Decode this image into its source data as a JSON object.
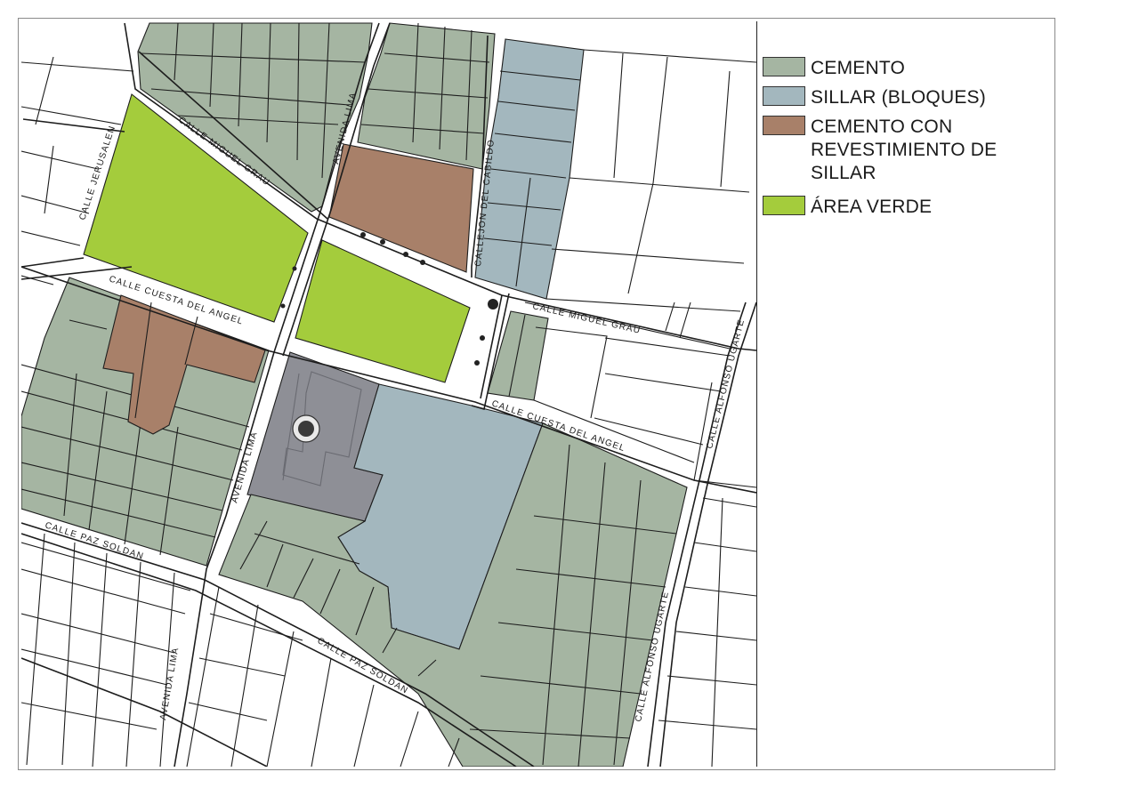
{
  "legend": {
    "items": [
      {
        "key": "cemento",
        "label": "CEMENTO",
        "color": "#a5b5a2"
      },
      {
        "key": "sillar",
        "label": "SILLAR (BLOQUES)",
        "color": "#a3b7be"
      },
      {
        "key": "revestimiento",
        "label": "CEMENTO CON\nREVESTIMIENTO DE\nSILLAR",
        "color": "#a88069"
      },
      {
        "key": "area_verde",
        "label": "ÁREA VERDE",
        "color": "#a4cc3c"
      }
    ]
  },
  "plaza": {
    "color": "#8e8f96"
  },
  "streets": [
    {
      "key": "jerusalen",
      "label": "CALLE JERUSALEN"
    },
    {
      "key": "miguel_grau_1",
      "label": "CALLE MIGUEL GRAU"
    },
    {
      "key": "lima_1",
      "label": "AVENIDA LIMA"
    },
    {
      "key": "cabildo",
      "label": "CALLEJON DEL CABILDO"
    },
    {
      "key": "miguel_grau_2",
      "label": "CALLE MIGUEL GRAU"
    },
    {
      "key": "cuesta_1",
      "label": "CALLE CUESTA DEL ANGEL"
    },
    {
      "key": "cuesta_2",
      "label": "CALLE CUESTA DEL ANGEL"
    },
    {
      "key": "lima_2",
      "label": "AVENIDA LIMA"
    },
    {
      "key": "ugarte_1",
      "label": "CALLE ALFONSO UGARTE"
    },
    {
      "key": "paz_1",
      "label": "CALLE PAZ SOLDAN"
    },
    {
      "key": "paz_2",
      "label": "CALLE PAZ SOLDAN"
    },
    {
      "key": "lima_3",
      "label": "AVENIDA LIMA"
    },
    {
      "key": "ugarte_2",
      "label": "CALLE ALFONSO UGARTE"
    }
  ]
}
